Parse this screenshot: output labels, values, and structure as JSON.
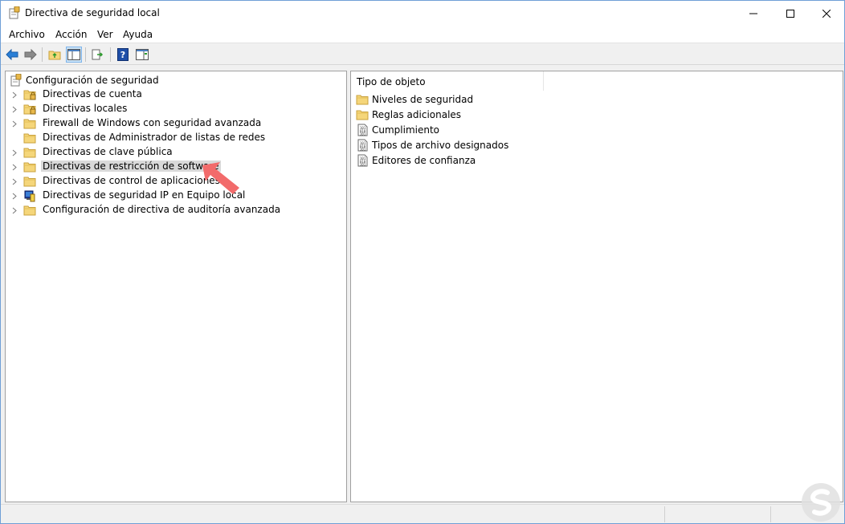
{
  "window": {
    "title": "Directiva de seguridad local"
  },
  "menu": {
    "items": [
      "Archivo",
      "Acción",
      "Ver",
      "Ayuda"
    ]
  },
  "tree": {
    "root": "Configuración de seguridad",
    "items": [
      {
        "label": "Directivas de cuenta",
        "icon": "folder-lock-icon",
        "expandable": true
      },
      {
        "label": "Directivas locales",
        "icon": "folder-lock-icon",
        "expandable": true
      },
      {
        "label": "Firewall de Windows con seguridad avanzada",
        "icon": "folder-icon",
        "expandable": true
      },
      {
        "label": "Directivas de Administrador de listas de redes",
        "icon": "folder-icon",
        "expandable": false
      },
      {
        "label": "Directivas de clave pública",
        "icon": "folder-icon",
        "expandable": true
      },
      {
        "label": "Directivas de restricción de software",
        "icon": "folder-icon",
        "expandable": true,
        "selected": true
      },
      {
        "label": "Directivas de control de aplicaciones",
        "icon": "folder-icon",
        "expandable": true
      },
      {
        "label": "Directivas de seguridad IP en Equipo local",
        "icon": "ip-security-icon",
        "expandable": true
      },
      {
        "label": "Configuración de directiva de auditoría avanzada",
        "icon": "folder-icon",
        "expandable": true
      }
    ]
  },
  "list": {
    "column": "Tipo de objeto",
    "items": [
      {
        "label": "Niveles de seguridad",
        "icon": "folder-icon"
      },
      {
        "label": "Reglas adicionales",
        "icon": "folder-icon"
      },
      {
        "label": "Cumplimiento",
        "icon": "binary-doc-icon"
      },
      {
        "label": "Tipos de archivo designados",
        "icon": "binary-doc-icon"
      },
      {
        "label": "Editores de confianza",
        "icon": "binary-doc-icon"
      }
    ]
  },
  "colors": {
    "folder": "#f5d67a",
    "selection": "#d9d9d9",
    "arrow": "#f26b6b",
    "accent": "#0a6fd1"
  }
}
